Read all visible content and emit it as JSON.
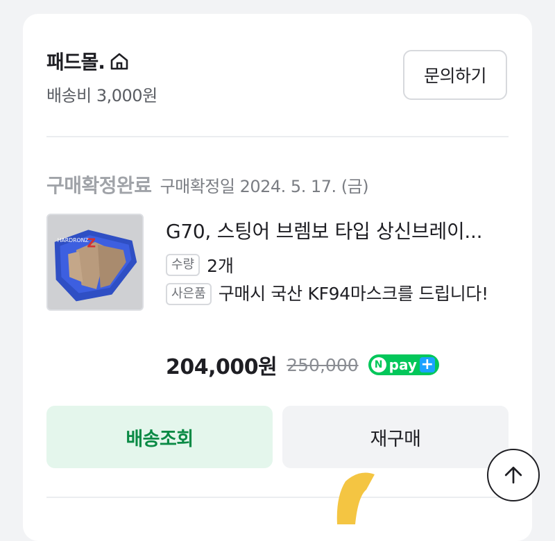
{
  "store": {
    "name": "패드몰.",
    "home_icon": "home-icon",
    "shipping_fee": "배송비 3,000원",
    "inquiry_label": "문의하기"
  },
  "order": {
    "status": "구매확정완료",
    "confirm_date": "구매확정일 2024. 5. 17. (금)"
  },
  "product": {
    "title": "G70, 스팅어 브렘보 타입 상신브레이...",
    "qty_tag": "수량",
    "qty_value": "2개",
    "gift_tag": "사은품",
    "gift_text": "구매시 국산 KF94마스크를 드립니다!",
    "price": "204,000원",
    "original_price": "250,000",
    "npay_label": "pay"
  },
  "actions": {
    "track_label": "배송조회",
    "rebuy_label": "재구매"
  },
  "colors": {
    "accent_green": "#0a8a45",
    "npay_green": "#03c75a",
    "npay_blue": "#1aa3ff"
  }
}
